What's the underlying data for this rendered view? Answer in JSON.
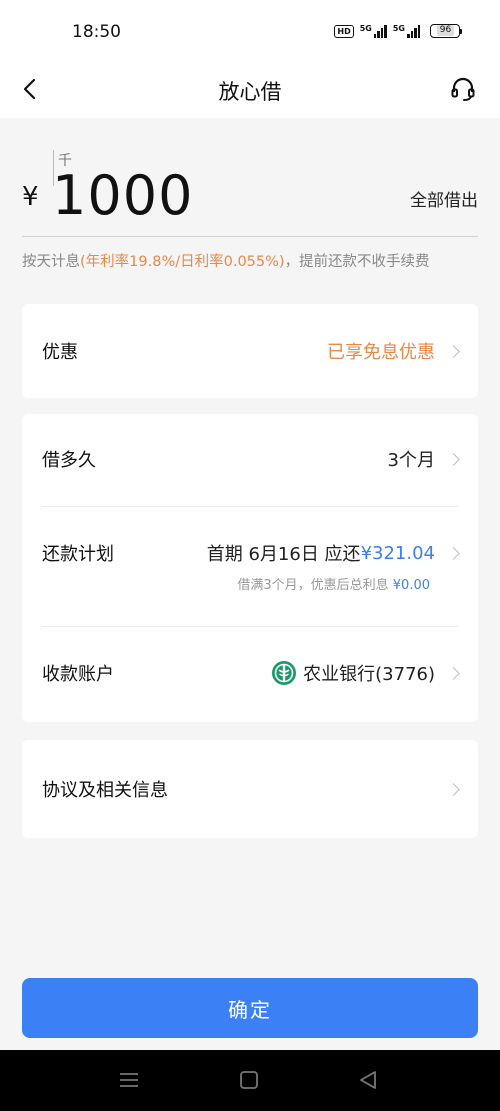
{
  "status_bar": {
    "time": "18:50",
    "hd": "HD",
    "network1": "5G",
    "network2": "5G",
    "battery": "96"
  },
  "header": {
    "title": "放心借",
    "back_icon": "chevron-left-icon",
    "service_icon": "headset-icon"
  },
  "amount": {
    "unit_hint": "千",
    "currency": "¥",
    "value": "1000",
    "borrow_all": "全部借出"
  },
  "rate_note": {
    "prefix": "按天计息",
    "highlight": "(年利率19.8%/日利率0.055%)",
    "suffix": "，提前还款不收手续费"
  },
  "discount": {
    "label": "优惠",
    "value": "已享免息优惠"
  },
  "loan_details": {
    "term_label": "借多久",
    "term_value": "3个月",
    "plan_label": "还款计划",
    "plan_prefix": "首期 6月16日 应还 ",
    "plan_amount": "¥321.04",
    "plan_note_prefix": "借满3个月，优惠后总利息 ",
    "plan_note_amount": "¥0.00",
    "account_label": "收款账户",
    "account_value": "农业银行(3776)",
    "bank_icon": "abc-bank-icon"
  },
  "agreement": {
    "label": "协议及相关信息"
  },
  "confirm_label": "确定",
  "colors": {
    "accent_blue": "#3c80f6",
    "orange": "#e8884a",
    "bank_green": "#1a9b6c"
  }
}
